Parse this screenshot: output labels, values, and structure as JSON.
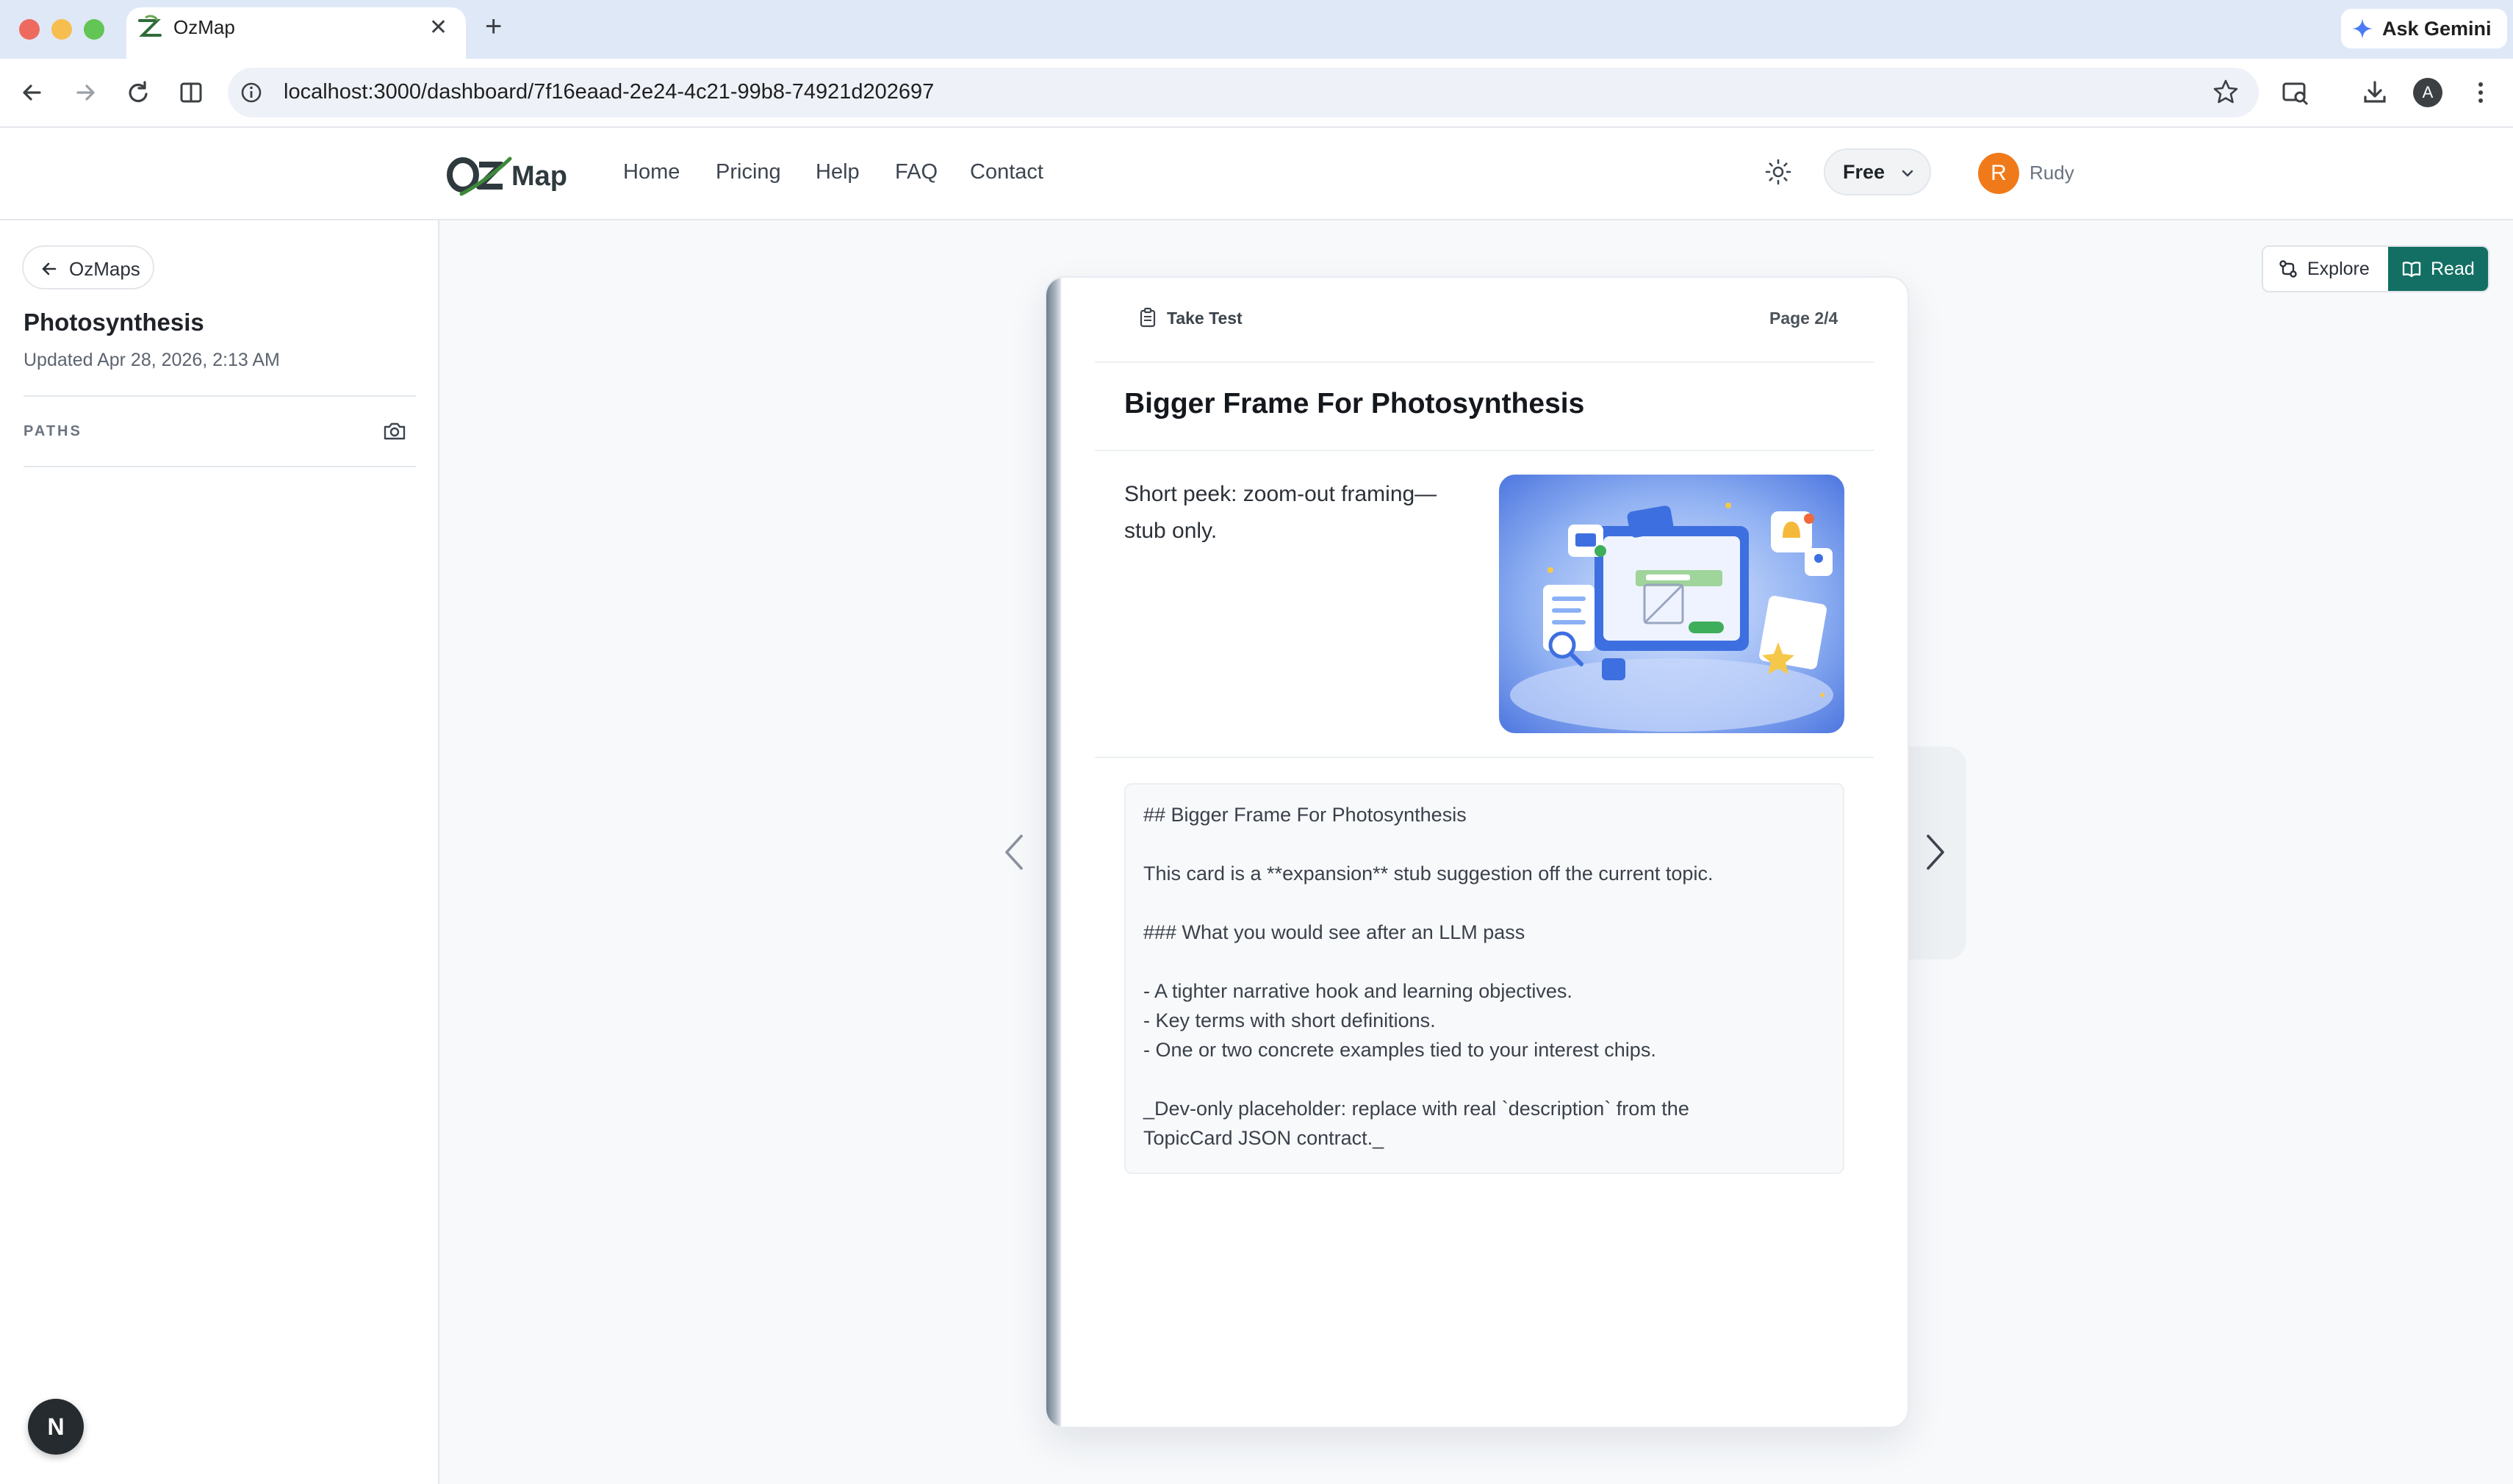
{
  "browser": {
    "tab_title": "OzMap",
    "url": "localhost:3000/dashboard/7f16eaad-2e24-4c21-99b8-74921d202697",
    "ask_gemini": "Ask Gemini",
    "profile_initial": "A"
  },
  "header": {
    "nav": [
      "Home",
      "Pricing",
      "Help",
      "FAQ",
      "Contact"
    ],
    "plan_label": "Free",
    "user_initial": "R",
    "user_name": "Rudy"
  },
  "sidebar": {
    "back_label": "OzMaps",
    "title": "Photosynthesis",
    "updated": "Updated Apr 28, 2026, 2:13 AM",
    "paths_heading": "PATHS",
    "dev_badge": "N"
  },
  "modes": {
    "explore_label": "Explore",
    "read_label": "Read",
    "active": "Read"
  },
  "card": {
    "take_test_label": "Take Test",
    "page_indicator": "Page 2/4",
    "title": "Bigger Frame For Photosynthesis",
    "peek_text": "Short peek: zoom-out framing—stub only.",
    "markdown_lines": [
      "## Bigger Frame For Photosynthesis",
      "",
      "This card is a **expansion** stub suggestion off the current topic.",
      "",
      "### What you would see after an LLM pass",
      "",
      "- A tighter narrative hook and learning objectives.",
      "- Key terms with short definitions.",
      "- One or two concrete examples tied to your interest chips.",
      "",
      "_Dev-only placeholder: replace with real `description` from the",
      "TopicCard JSON contract._"
    ]
  },
  "colors": {
    "accent": "#136f63",
    "avatar": "#f07a1a"
  }
}
